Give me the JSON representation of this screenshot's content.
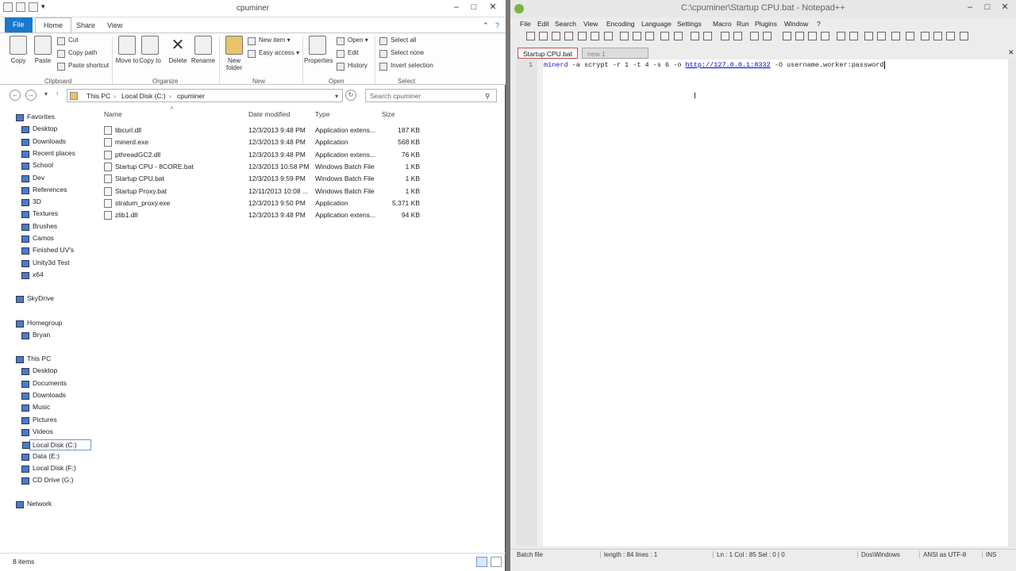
{
  "explorer": {
    "title": "cpuminer",
    "tabs": {
      "file": "File",
      "home": "Home",
      "share": "Share",
      "view": "View"
    },
    "ribbon": {
      "clipboard": {
        "label": "Clipboard",
        "copy": "Copy",
        "paste": "Paste",
        "cut": "Cut",
        "copy_path": "Copy path",
        "paste_shortcut": "Paste shortcut"
      },
      "organize": {
        "label": "Organize",
        "move_to": "Move to",
        "copy_to": "Copy to",
        "delete": "Delete",
        "rename": "Rename"
      },
      "new": {
        "label": "New",
        "new_folder": "New folder",
        "new_item": "New item",
        "easy_access": "Easy access"
      },
      "open": {
        "label": "Open",
        "properties": "Properties",
        "open": "Open",
        "edit": "Edit",
        "history": "History"
      },
      "select": {
        "label": "Select",
        "select_all": "Select all",
        "select_none": "Select none",
        "invert_selection": "Invert selection"
      }
    },
    "address": {
      "crumbs": [
        "This PC",
        "Local Disk (C:)",
        "cpuminer"
      ],
      "search_placeholder": "Search cpuminer"
    },
    "nav": {
      "favorites": "Favorites",
      "favorites_items": [
        "Desktop",
        "Downloads",
        "Recent places",
        "School",
        "Dev",
        "References",
        "3D",
        "Textures",
        "Brushes",
        "Camos",
        "Finished UV's",
        "Unity3d Test",
        "x64"
      ],
      "skydrive": "SkyDrive",
      "homegroup": "Homegroup",
      "homegroup_items": [
        "Bryan"
      ],
      "thispc": "This PC",
      "thispc_items": [
        "Desktop",
        "Documents",
        "Downloads",
        "Music",
        "Pictures",
        "Videos",
        "Local Disk (C:)",
        "Data (E:)",
        "Local Disk (F:)",
        "CD Drive (G:)"
      ],
      "network": "Network"
    },
    "columns": {
      "name": "Name",
      "date": "Date modified",
      "type": "Type",
      "size": "Size"
    },
    "files": [
      {
        "name": "libcurl.dll",
        "date": "12/3/2013 9:48 PM",
        "type": "Application extens...",
        "size": "187 KB"
      },
      {
        "name": "minerd.exe",
        "date": "12/3/2013 9:48 PM",
        "type": "Application",
        "size": "568 KB"
      },
      {
        "name": "pthreadGC2.dll",
        "date": "12/3/2013 9:48 PM",
        "type": "Application extens...",
        "size": "76 KB"
      },
      {
        "name": "Startup CPU - 8CORE.bat",
        "date": "12/3/2013 10:58 PM",
        "type": "Windows Batch File",
        "size": "1 KB"
      },
      {
        "name": "Startup CPU.bat",
        "date": "12/3/2013 9:59 PM",
        "type": "Windows Batch File",
        "size": "1 KB"
      },
      {
        "name": "Startup Proxy.bat",
        "date": "12/11/2013 10:08 ...",
        "type": "Windows Batch File",
        "size": "1 KB"
      },
      {
        "name": "stratum_proxy.exe",
        "date": "12/3/2013 9:50 PM",
        "type": "Application",
        "size": "5,371 KB"
      },
      {
        "name": "zlib1.dll",
        "date": "12/3/2013 9:48 PM",
        "type": "Application extens...",
        "size": "94 KB"
      }
    ],
    "status": "8 items"
  },
  "notepad": {
    "title": "C:\\cpuminer\\Startup CPU.bat - Notepad++",
    "menu": [
      "File",
      "Edit",
      "Search",
      "View",
      "Encoding",
      "Language",
      "Settings",
      "Macro",
      "Run",
      "Plugins",
      "Window",
      "?"
    ],
    "tabs": [
      "Startup CPU.bat",
      "new 1"
    ],
    "line_number": "1",
    "code": {
      "cmd": "minerd",
      "args": " -a scrypt -r 1 -t 4 -s 6 -o ",
      "url": "http://127.0.0.1:8332",
      "tail": " -O username.worker:password"
    },
    "status": {
      "type": "Batch file",
      "length": "length : 84    lines : 1",
      "pos": "Ln : 1    Col : 85    Sel : 0 | 0",
      "eol": "Dos\\Windows",
      "enc": "ANSI as UTF-8",
      "mode": "INS"
    }
  }
}
